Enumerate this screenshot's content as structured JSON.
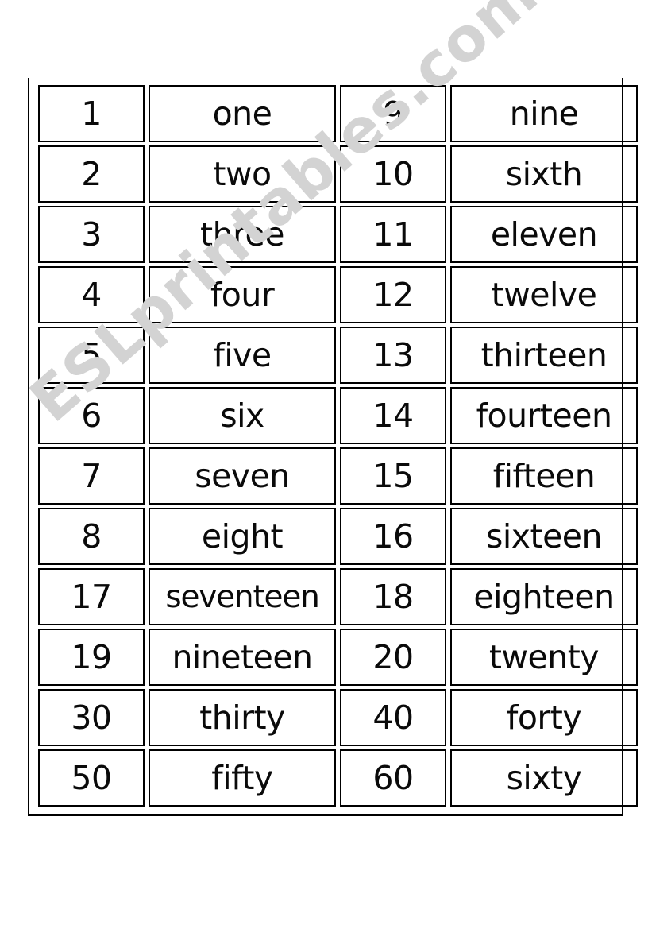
{
  "page": {
    "background_color": "#ffffff",
    "ink_color": "#0a0a0a",
    "frame_color": "#000000"
  },
  "watermark": {
    "text": "ESLprintables.com",
    "color": "#d3d3d3",
    "rotation_deg": -41
  },
  "table": {
    "columns": [
      "numeral",
      "word",
      "numeral",
      "word"
    ],
    "row_count": 12,
    "rows": [
      {
        "left_numeral": "1",
        "left_word": "one",
        "right_numeral": "9",
        "right_word": "nine"
      },
      {
        "left_numeral": "2",
        "left_word": "two",
        "right_numeral": "10",
        "right_word": "sixth"
      },
      {
        "left_numeral": "3",
        "left_word": "three",
        "right_numeral": "11",
        "right_word": "eleven"
      },
      {
        "left_numeral": "4",
        "left_word": "four",
        "right_numeral": "12",
        "right_word": "twelve"
      },
      {
        "left_numeral": "5",
        "left_word": "five",
        "right_numeral": "13",
        "right_word": "thirteen"
      },
      {
        "left_numeral": "6",
        "left_word": "six",
        "right_numeral": "14",
        "right_word": "fourteen"
      },
      {
        "left_numeral": "7",
        "left_word": "seven",
        "right_numeral": "15",
        "right_word": "fifteen"
      },
      {
        "left_numeral": "8",
        "left_word": "eight",
        "right_numeral": "16",
        "right_word": "sixteen"
      },
      {
        "left_numeral": "17",
        "left_word": "seventeen",
        "right_numeral": "18",
        "right_word": "eighteen"
      },
      {
        "left_numeral": "19",
        "left_word": "nineteen",
        "right_numeral": "20",
        "right_word": "twenty"
      },
      {
        "left_numeral": "30",
        "left_word": "thirty",
        "right_numeral": "40",
        "right_word": "forty"
      },
      {
        "left_numeral": "50",
        "left_word": "fifty",
        "right_numeral": "60",
        "right_word": "sixty"
      }
    ]
  }
}
